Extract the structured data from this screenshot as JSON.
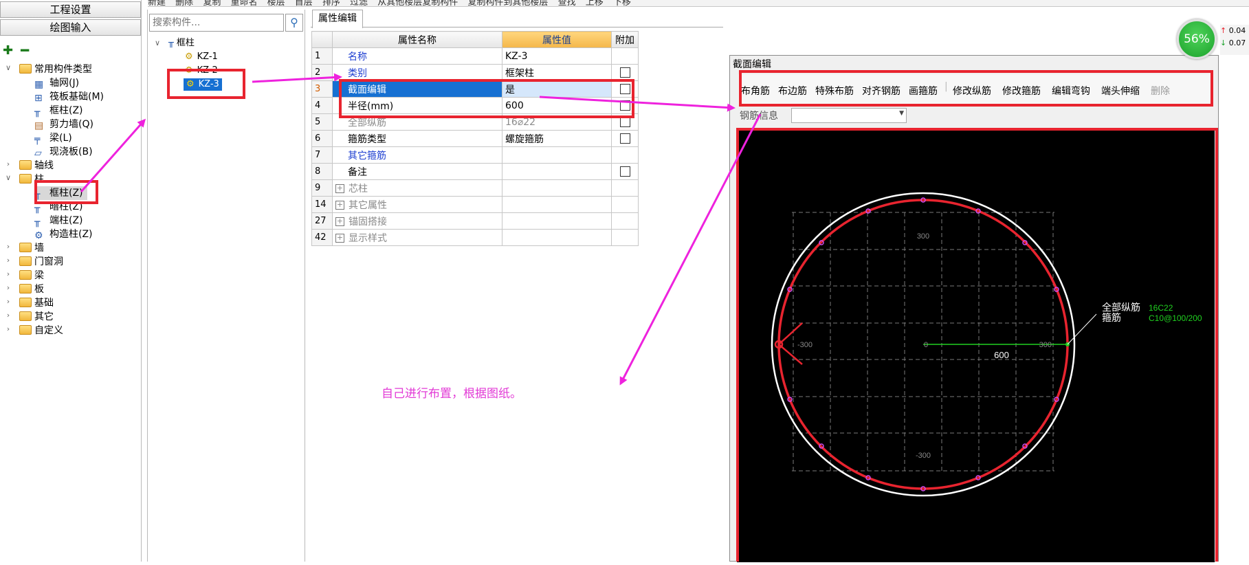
{
  "toolbar": {
    "items": [
      "新建",
      "删除",
      "复制",
      "重命名",
      "楼层",
      "首层",
      "排序",
      "过滤",
      "从其他楼层复制构件",
      "复制构件到其他楼层",
      "查找",
      "上移",
      "下移"
    ]
  },
  "nav": {
    "project_settings": "工程设置",
    "drawing_input": "绘图输入",
    "tree": {
      "common_types": "常用构件类型",
      "common_items": [
        "轴网(J)",
        "筏板基础(M)",
        "框柱(Z)",
        "剪力墙(Q)",
        "梁(L)",
        "现浇板(B)"
      ],
      "axis": "轴线",
      "column": "柱",
      "column_items": [
        "框柱(Z)",
        "暗柱(Z)",
        "端柱(Z)",
        "构造柱(Z)"
      ],
      "others": [
        "墙",
        "门窗洞",
        "梁",
        "板",
        "基础",
        "其它",
        "自定义"
      ]
    }
  },
  "components": {
    "search_placeholder": "搜索构件...",
    "root": "框柱",
    "items": [
      "KZ-1",
      "KZ-2",
      "KZ-3"
    ]
  },
  "properties": {
    "tab": "属性编辑",
    "headers": [
      "属性名称",
      "属性值",
      "附加"
    ],
    "rows": [
      {
        "num": "1",
        "name": "名称",
        "value": "KZ-3"
      },
      {
        "num": "2",
        "name": "类别",
        "value": "框架柱"
      },
      {
        "num": "3",
        "name": "截面编辑",
        "value": "是"
      },
      {
        "num": "4",
        "name": "半径(mm)",
        "value": "600"
      },
      {
        "num": "5",
        "name": "全部纵筋",
        "value": "16⌀22"
      },
      {
        "num": "6",
        "name": "箍筋类型",
        "value": "螺旋箍筋"
      },
      {
        "num": "7",
        "name": "其它箍筋",
        "value": ""
      },
      {
        "num": "8",
        "name": "备注",
        "value": ""
      },
      {
        "num": "9",
        "name": "芯柱",
        "value": ""
      },
      {
        "num": "14",
        "name": "其它属性",
        "value": ""
      },
      {
        "num": "27",
        "name": "锚固搭接",
        "value": ""
      },
      {
        "num": "42",
        "name": "显示样式",
        "value": ""
      }
    ]
  },
  "section_editor": {
    "title": "截面编辑",
    "tools": [
      "布角筋",
      "布边筋",
      "特殊布筋",
      "对齐钢筋",
      "画箍筋",
      "修改纵筋",
      "修改箍筋",
      "编辑弯钩",
      "端头伸缩",
      "删除"
    ],
    "rebar_info_label": "钢筋信息",
    "canvas": {
      "dim_top": "300",
      "dim_bottom": "-300",
      "dim_left": "-300",
      "dim_right": "300",
      "center": "0",
      "radius_label": "600",
      "callout_label1": "全部纵筋",
      "callout_value1": "16C22",
      "callout_label2": "箍筋",
      "callout_value2": "C10@100/200"
    }
  },
  "annotation": {
    "note": "自己进行布置，根据图纸。"
  },
  "status": {
    "cpu": "56%",
    "up": "0.04",
    "down": "0.07"
  },
  "colors": {
    "annotation": "#e23ad6",
    "highlight_box": "#e8242f",
    "selection": "#1670d2"
  }
}
